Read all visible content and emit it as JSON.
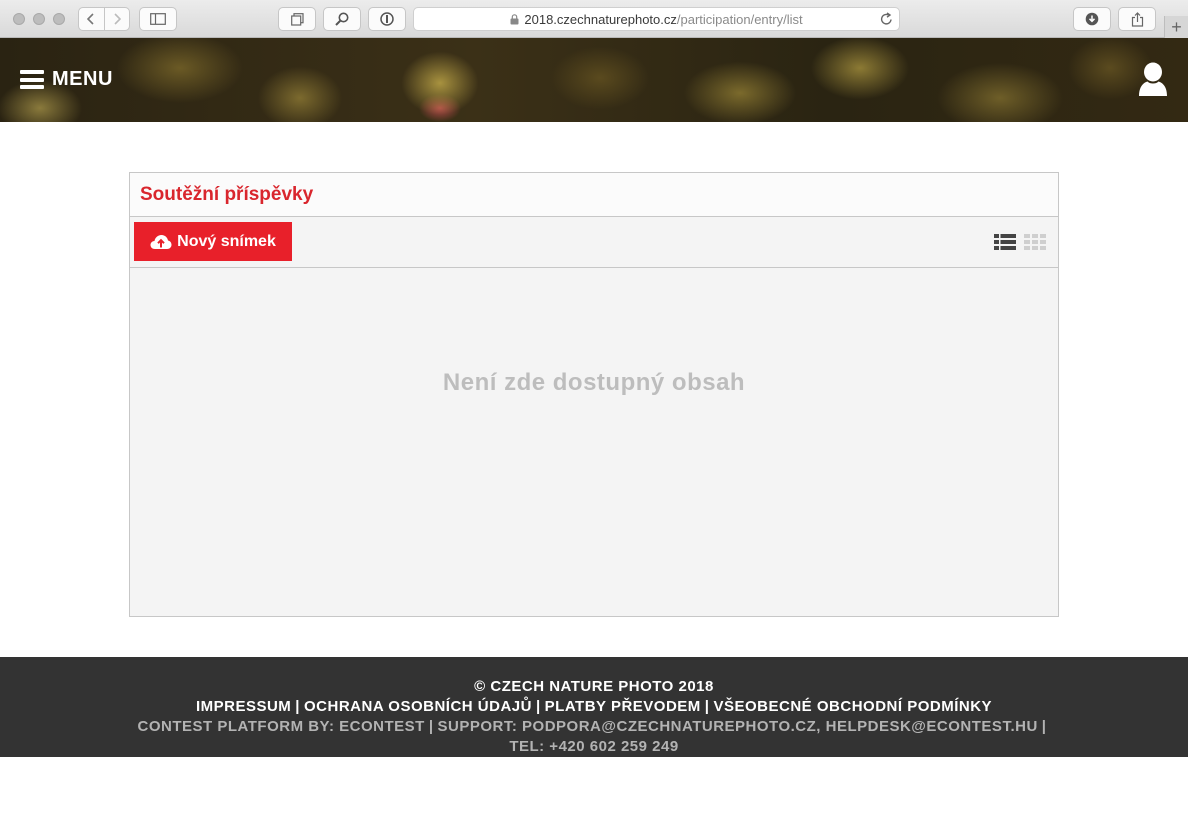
{
  "browser": {
    "url_domain": "2018.czechnaturephoto.cz",
    "url_path": "/participation/entry/list",
    "new_tab_label": "+"
  },
  "header": {
    "menu_label": "MENU"
  },
  "panel": {
    "title": "Soutěžní příspěvky",
    "new_button_label": "Nový snímek",
    "empty_message": "Není zde dostupný obsah"
  },
  "footer": {
    "copyright": "© CZECH NATURE PHOTO 2018",
    "links": [
      "IMPRESSUM",
      "OCHRANA OSOBNÍCH ÚDAJŮ",
      "PLATBY PŘEVODEM",
      "VŠEOBECNÉ OBCHODNÍ PODMÍNKY"
    ],
    "platform_prefix": "CONTEST PLATFORM BY:",
    "platform_name": "ECONTEST",
    "support_prefix": "SUPPORT:",
    "support_email_1": "PODPORA@CZECHNATUREPHOTO.CZ,",
    "support_email_2": "HELPDESK@ECONTEST.HU",
    "phone": "TEL: +420 602 259 249"
  },
  "colors": {
    "accent_red": "#e8202a",
    "title_red": "#d9262d",
    "footer_bg": "#333333"
  }
}
